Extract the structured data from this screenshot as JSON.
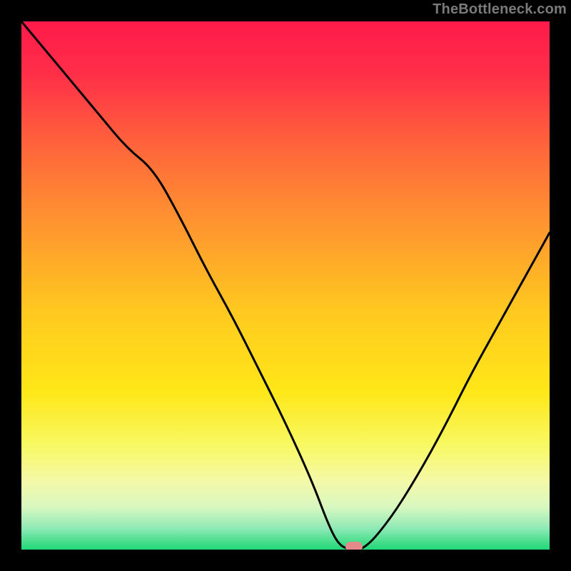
{
  "watermark": "TheBottleneck.com",
  "chart_data": {
    "type": "line",
    "title": "",
    "xlabel": "",
    "ylabel": "",
    "xlim": [
      0,
      100
    ],
    "ylim": [
      0,
      100
    ],
    "x": [
      0,
      5,
      10,
      15,
      20,
      25,
      30,
      35,
      40,
      45,
      50,
      55,
      58,
      60,
      62,
      65,
      70,
      75,
      80,
      85,
      90,
      95,
      100
    ],
    "values": [
      100,
      94,
      88,
      82,
      76,
      72,
      63,
      53,
      44,
      34,
      24,
      13,
      5,
      1,
      0,
      0,
      6,
      14,
      23,
      33,
      42,
      51,
      60
    ],
    "optimum_x": 63,
    "background": {
      "type": "vertical-gradient",
      "stops": [
        {
          "pos": 0.0,
          "color": "#ff1a4a"
        },
        {
          "pos": 0.1,
          "color": "#ff2f48"
        },
        {
          "pos": 0.25,
          "color": "#ff6a3a"
        },
        {
          "pos": 0.4,
          "color": "#ff9a2e"
        },
        {
          "pos": 0.55,
          "color": "#ffc91f"
        },
        {
          "pos": 0.7,
          "color": "#ffe718"
        },
        {
          "pos": 0.8,
          "color": "#f8f860"
        },
        {
          "pos": 0.87,
          "color": "#f4f9a8"
        },
        {
          "pos": 0.92,
          "color": "#d8f7c0"
        },
        {
          "pos": 0.96,
          "color": "#8ee9b4"
        },
        {
          "pos": 1.0,
          "color": "#1fd877"
        }
      ]
    },
    "marker_color": "#e48a8a"
  }
}
